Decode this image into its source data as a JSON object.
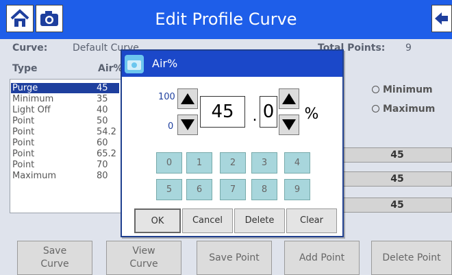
{
  "header": {
    "title": "Edit Profile Curve",
    "home_icon": "home-icon",
    "camera_icon": "camera-icon",
    "back_icon": "back-arrow-icon",
    "color": "#1e5ee9"
  },
  "info": {
    "curve_label": "Curve:",
    "curve_value": "Default Curve",
    "total_points_label": "Total Points:",
    "total_points_value": "9",
    "col_type": "Type",
    "col_air": "Air%"
  },
  "points": [
    {
      "type": "Purge",
      "air": "45",
      "selected": true
    },
    {
      "type": "Minimum",
      "air": "35"
    },
    {
      "type": "Light Off",
      "air": "40"
    },
    {
      "type": "Point",
      "air": "50"
    },
    {
      "type": "Point",
      "air": "54.2"
    },
    {
      "type": "Point",
      "air": "60"
    },
    {
      "type": "Point",
      "air": "65.2"
    },
    {
      "type": "Point",
      "air": "70"
    },
    {
      "type": "Maximum",
      "air": "80"
    }
  ],
  "radios": {
    "minimum": "Minimum",
    "maximum": "Maximum"
  },
  "values": [
    "45",
    "45",
    "45"
  ],
  "buttons": {
    "save_curve_1": "Save",
    "save_curve_2": "Curve",
    "view_curve_1": "View",
    "view_curve_2": "Curve",
    "save_point": "Save Point",
    "add_point": "Add Point",
    "delete_point": "Delete Point"
  },
  "dialog": {
    "title": "Air%",
    "max": "100",
    "min": "0",
    "integer": "45",
    "dot": ".",
    "decimal": "0",
    "unit": "%",
    "keys": [
      "0",
      "1",
      "2",
      "3",
      "4",
      "5",
      "6",
      "7",
      "8",
      "9"
    ],
    "ok": "OK",
    "cancel": "Cancel",
    "delete": "Delete",
    "clear": "Clear"
  }
}
